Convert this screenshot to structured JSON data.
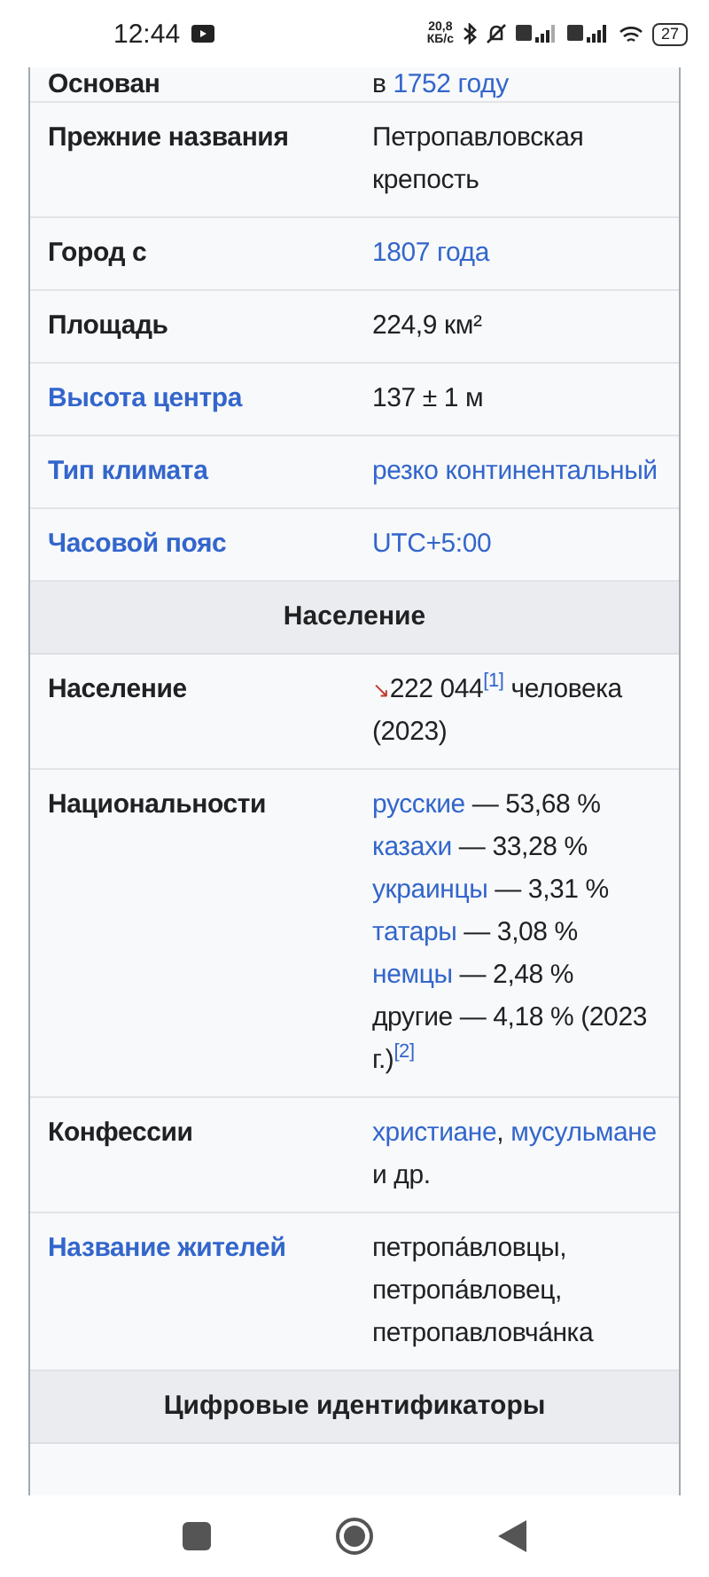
{
  "status_bar": {
    "time": "12:44",
    "speed": "20,8\nКБ/с",
    "battery": "27"
  },
  "infobox": [
    {
      "kind": "row",
      "label": "Основан",
      "label_link": false,
      "lines": [
        [
          {
            "kind": "text",
            "text": "в "
          },
          {
            "kind": "link",
            "text": "1752 году"
          }
        ]
      ]
    },
    {
      "kind": "row",
      "label": "Прежние названия",
      "label_link": false,
      "lines": [
        [
          {
            "kind": "text",
            "text": "Петропавловская крепость"
          }
        ]
      ]
    },
    {
      "kind": "row",
      "label": "Город с",
      "label_link": false,
      "lines": [
        [
          {
            "kind": "link",
            "text": "1807 года"
          }
        ]
      ]
    },
    {
      "kind": "row",
      "label": "Площадь",
      "label_link": false,
      "lines": [
        [
          {
            "kind": "text",
            "text": "224,9 км²"
          }
        ]
      ]
    },
    {
      "kind": "row",
      "label": "Высота центра",
      "label_link": true,
      "lines": [
        [
          {
            "kind": "text",
            "text": "137 ± 1 м"
          }
        ]
      ]
    },
    {
      "kind": "row",
      "label": "Тип климата",
      "label_link": true,
      "lines": [
        [
          {
            "kind": "link",
            "text": "резко континентальный"
          }
        ]
      ]
    },
    {
      "kind": "row",
      "label": "Часовой пояс",
      "label_link": true,
      "lines": [
        [
          {
            "kind": "link",
            "text": "UTC+5:00"
          }
        ]
      ]
    },
    {
      "kind": "header",
      "label": "Население"
    },
    {
      "kind": "row",
      "label": "Население",
      "label_link": false,
      "lines": [
        [
          {
            "kind": "trend",
            "text": "↘"
          },
          {
            "kind": "text",
            "text": "222 044"
          },
          {
            "kind": "ref",
            "text": "[1]"
          },
          {
            "kind": "text",
            "text": " человека"
          }
        ],
        [
          {
            "kind": "text",
            "text": "(2023)"
          }
        ]
      ]
    },
    {
      "kind": "row",
      "label": "Национальности",
      "label_link": false,
      "lines": [
        [
          {
            "kind": "link",
            "text": "русские"
          },
          {
            "kind": "text",
            "text": " — 53,68 %"
          }
        ],
        [
          {
            "kind": "link",
            "text": "казахи"
          },
          {
            "kind": "text",
            "text": " — 33,28 %"
          }
        ],
        [
          {
            "kind": "link",
            "text": "украинцы"
          },
          {
            "kind": "text",
            "text": " — 3,31 %"
          }
        ],
        [
          {
            "kind": "link",
            "text": "татары"
          },
          {
            "kind": "text",
            "text": " — 3,08 %"
          }
        ],
        [
          {
            "kind": "link",
            "text": "немцы"
          },
          {
            "kind": "text",
            "text": " — 2,48 %"
          }
        ],
        [
          {
            "kind": "text",
            "text": "другие — 4,18 % (2023"
          }
        ],
        [
          {
            "kind": "text",
            "text": "г.)"
          },
          {
            "kind": "ref",
            "text": "[2]"
          }
        ]
      ]
    },
    {
      "kind": "row",
      "label": "Конфессии",
      "label_link": false,
      "lines": [
        [
          {
            "kind": "link",
            "text": "христиане"
          },
          {
            "kind": "text",
            "text": ", "
          },
          {
            "kind": "link",
            "text": "мусульмане"
          },
          {
            "kind": "text",
            "text": " и др."
          }
        ]
      ]
    },
    {
      "kind": "row",
      "label": "Название жителей",
      "label_link": true,
      "lines": [
        [
          {
            "kind": "text",
            "text": "петропа́вловцы, петропа́вловец, петропавловча́нка"
          }
        ]
      ]
    },
    {
      "kind": "header",
      "label": "Цифровые идентификаторы"
    },
    {
      "kind": "partial"
    }
  ]
}
